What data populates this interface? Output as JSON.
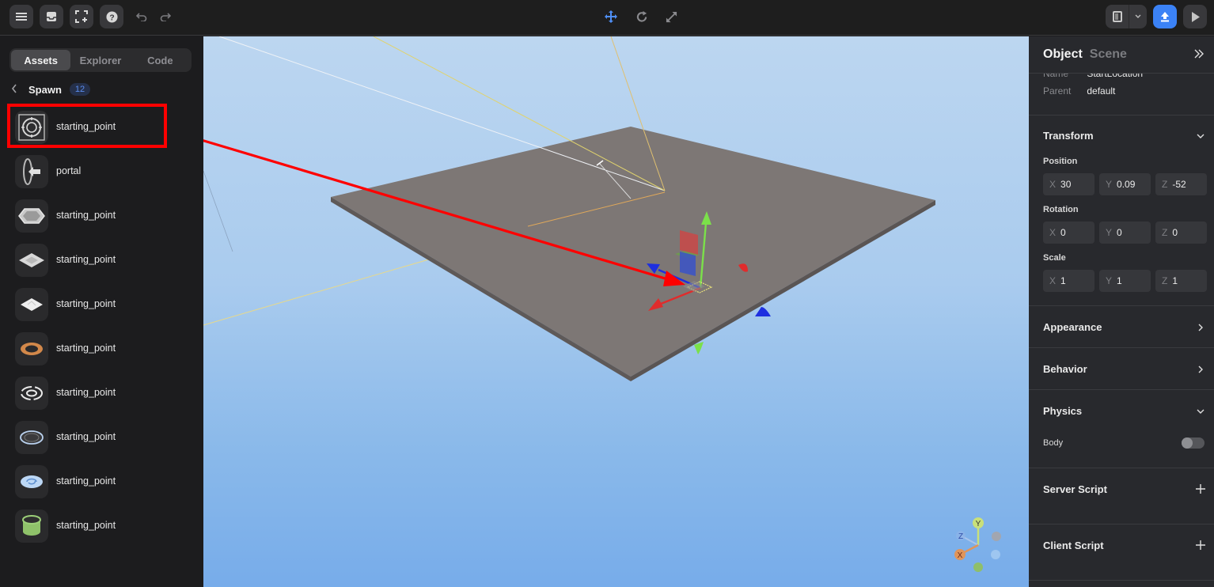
{
  "toolbar": {
    "left_buttons": [
      {
        "name": "menu-button",
        "icon": "menu-icon"
      },
      {
        "name": "inbox-button",
        "icon": "inbox-icon"
      },
      {
        "name": "add-frame-button",
        "icon": "frame-add-icon"
      },
      {
        "name": "help-button",
        "icon": "help-icon"
      }
    ],
    "history": [
      {
        "icon": "undo-icon"
      },
      {
        "icon": "redo-icon"
      }
    ],
    "transform_tools": [
      {
        "icon": "move-icon",
        "active": true
      },
      {
        "icon": "rotate-icon",
        "active": false
      },
      {
        "icon": "scale-icon",
        "active": false
      }
    ],
    "right_buttons": [
      {
        "icon": "layout-icon"
      },
      {
        "icon": "chevron-down-icon"
      },
      {
        "icon": "publish-icon"
      },
      {
        "icon": "play-icon"
      }
    ],
    "accent": "#3b82f6",
    "active_tool_color": "#4f8ff7"
  },
  "left_panel": {
    "tabs": [
      {
        "label": "Assets",
        "active": true
      },
      {
        "label": "Explorer",
        "active": false
      },
      {
        "label": "Code",
        "active": false
      }
    ],
    "breadcrumb": {
      "back_icon": "chevron-left-icon",
      "title": "Spawn",
      "count": "12"
    },
    "assets": [
      {
        "label": "starting_point",
        "thumb": "crosshair-target",
        "highlighted": true
      },
      {
        "label": "portal",
        "thumb": "portal-ring"
      },
      {
        "label": "starting_point",
        "thumb": "hexagon-pad"
      },
      {
        "label": "starting_point",
        "thumb": "square-pad"
      },
      {
        "label": "starting_point",
        "thumb": "diamond-pad"
      },
      {
        "label": "starting_point",
        "thumb": "orange-ring"
      },
      {
        "label": "starting_point",
        "thumb": "orbit-ring"
      },
      {
        "label": "starting_point",
        "thumb": "dark-disc"
      },
      {
        "label": "starting_point",
        "thumb": "swirl-disc"
      },
      {
        "label": "starting_point",
        "thumb": "green-cylinder"
      }
    ]
  },
  "annotation": {
    "color": "#ff0000",
    "type": "arrow-from-asset-to-viewport"
  },
  "viewport": {
    "axis_gizmo": {
      "labels": [
        "Y",
        "Z",
        "X"
      ],
      "colors": {
        "x": "#e0955a",
        "y": "#c9e07a",
        "z": "#8fb3e8"
      }
    }
  },
  "right_panel": {
    "tabs": [
      {
        "label": "Object",
        "active": true
      },
      {
        "label": "Scene",
        "active": false
      }
    ],
    "properties": [
      {
        "key": "Name",
        "value": "StartLocation"
      },
      {
        "key": "Parent",
        "value": "default"
      }
    ],
    "transform": {
      "title": "Transform",
      "expanded": true,
      "position": {
        "label": "Position",
        "x": "30",
        "y": "0.09",
        "z": "-52"
      },
      "rotation": {
        "label": "Rotation",
        "x": "0",
        "y": "0",
        "z": "0"
      },
      "scale": {
        "label": "Scale",
        "x": "1",
        "y": "1",
        "z": "1"
      },
      "axis_labels": {
        "x": "X",
        "y": "Y",
        "z": "Z"
      }
    },
    "sections": [
      {
        "title": "Appearance",
        "icon": "chevron-right-icon"
      },
      {
        "title": "Behavior",
        "icon": "chevron-right-icon"
      },
      {
        "title": "Physics",
        "icon": "chevron-down-icon"
      }
    ],
    "physics": {
      "body_label": "Body",
      "body_enabled": false
    },
    "scripts": [
      {
        "title": "Server Script",
        "icon": "plus-icon"
      },
      {
        "title": "Client Script",
        "icon": "plus-icon"
      }
    ]
  }
}
